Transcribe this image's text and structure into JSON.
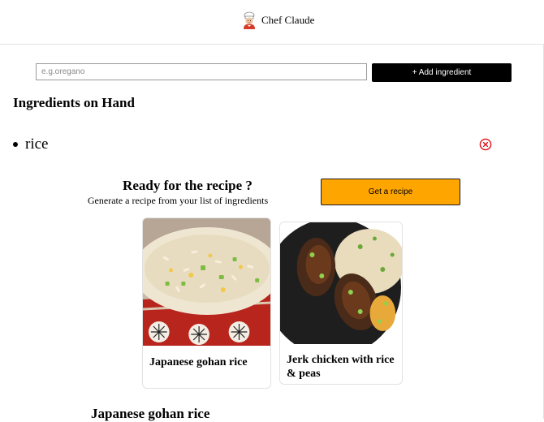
{
  "header": {
    "app_name": "Chef Claude",
    "logo_icon": "chef-icon"
  },
  "ingredient_form": {
    "input_placeholder": "e.g.oregano",
    "input_value": "",
    "add_button_label": "+ Add ingredient"
  },
  "ingredients_section": {
    "title": "Ingredients on Hand",
    "items": [
      {
        "name": "rice",
        "remove_icon": "remove-icon"
      }
    ]
  },
  "recipe_prompt": {
    "title": "Ready for the recipe ?",
    "subtitle": "Generate a recipe from your list of ingredients",
    "button_label": "Get a recipe"
  },
  "recipe_cards": [
    {
      "title": "Japanese gohan rice",
      "image": "fried-rice-image"
    },
    {
      "title": "Jerk chicken with rice & peas",
      "image": "jerk-chicken-image"
    }
  ],
  "selected_recipe": {
    "title": "Japanese gohan rice"
  },
  "colors": {
    "accent": "#ffa500",
    "primary_button": "#000000",
    "remove_icon": "#e0101a"
  }
}
